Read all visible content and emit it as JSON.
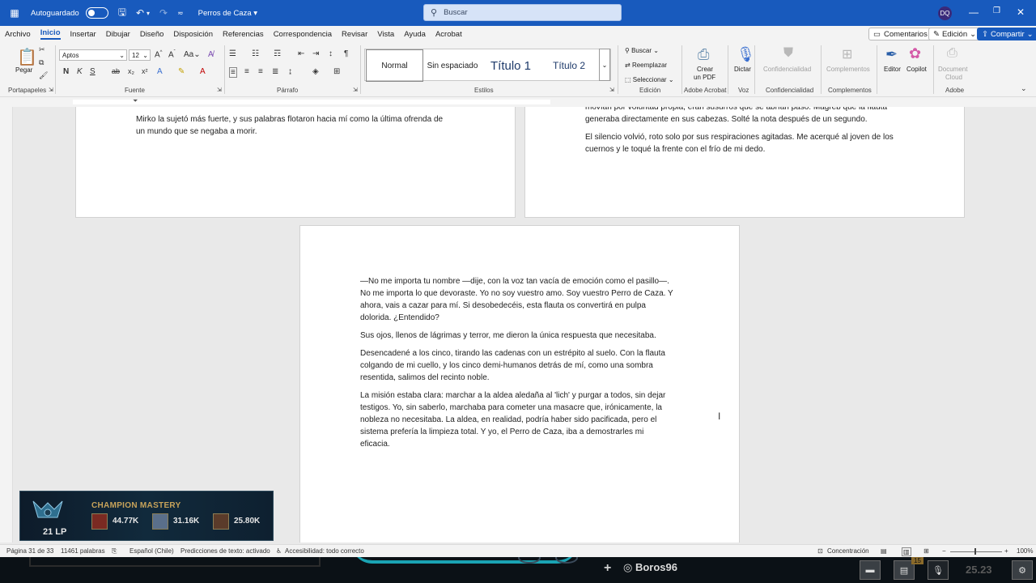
{
  "titlebar": {
    "autosave_label": "Autoguardado",
    "doc_title": "Perros de Caza",
    "search_placeholder": "Buscar",
    "user_initials": "DQ"
  },
  "menu": {
    "items": [
      "Archivo",
      "Inicio",
      "Insertar",
      "Dibujar",
      "Diseño",
      "Disposición",
      "Referencias",
      "Correspondencia",
      "Revisar",
      "Vista",
      "Ayuda",
      "Acrobat"
    ],
    "active": "Inicio",
    "comments_label": "Comentarios",
    "editing_label": "Edición",
    "share_label": "Compartir"
  },
  "ribbon": {
    "paste_label": "Pegar",
    "clipboard_label": "Portapapeles",
    "font_name": "Aptos",
    "font_size": "12",
    "font_label": "Fuente",
    "paragraph_label": "Párrafo",
    "styles_label": "Estilos",
    "styles": [
      "Normal",
      "Sin espaciado",
      "Título 1",
      "Título 2"
    ],
    "find_label": "Buscar",
    "replace_label": "Reemplazar",
    "select_label": "Seleccionar",
    "editing_group_label": "Edición",
    "create_pdf_line1": "Crear",
    "create_pdf_line2": "un PDF",
    "adobe_acrobat_label": "Adobe Acrobat",
    "dictate_label": "Dictar",
    "voice_label": "Voz",
    "confidentiality_btn": "Confidencialidad",
    "confidentiality_label": "Confidencialidad",
    "addins_btn": "Complementos",
    "addins_label": "Complementos",
    "editor_label": "Editor",
    "copilot_label": "Copilot",
    "document_cloud_line1": "Document",
    "document_cloud_line2": "Cloud",
    "adobe_label": "Adobe"
  },
  "pages": {
    "left_top": {
      "lines": [
        "Mirko la sujetó más fuerte, y sus palabras flotaron hacia mí como la última ofrenda de",
        "un mundo que se negaba a morir."
      ]
    },
    "right_top": {
      "p1_lines": [
        "movían por voluntad propia, eran susurros que se abrían paso. Magreb que la flauta",
        "generaba directamente en sus cabezas. Solté la nota después de un segundo."
      ],
      "p2_lines": [
        "El silencio volvió, roto solo por sus respiraciones agitadas. Me acerqué al joven de los",
        "cuernos y le toqué la frente con el frío de mi dedo."
      ]
    },
    "main": {
      "paragraphs": [
        [
          "—No me importa tu nombre —dije, con la voz tan vacía de emoción como el pasillo—.",
          "No me importa lo que devoraste. Yo no soy vuestro amo. Soy vuestro Perro de Caza. Y",
          "ahora, vais a cazar para mí. Si desobedecéis, esta flauta os convertirá en pulpa",
          "dolorida. ¿Entendido?"
        ],
        [
          "Sus ojos, llenos de lágrimas y terror, me dieron la única respuesta que necesitaba."
        ],
        [
          "Desencadené a los cinco, tirando las cadenas con un estrépito al suelo. Con la flauta",
          "colgando de mi cuello, y los cinco demi-humanos detrás de mí, como una sombra",
          "resentida, salimos del recinto noble."
        ],
        [
          "La misión estaba clara: marchar a la aldea aledaña al 'lich' y purgar a todos, sin dejar",
          "testigos. Yo, sin saberlo, marchaba para cometer una masacre que, irónicamente, la",
          "nobleza no necesitaba. La aldea, en realidad, podría haber sido pacificada, pero el",
          "sistema prefería la limpieza total. Y yo, el Perro de Caza, iba a demostrarles mi",
          "eficacia."
        ]
      ]
    }
  },
  "mastery": {
    "title": "CHAMPION MASTERY",
    "lp": "21 LP",
    "champions": [
      {
        "points": "44.77K",
        "color": "#7a2a22"
      },
      {
        "points": "31.16K",
        "color": "#5a6f8a"
      },
      {
        "points": "25.80K",
        "color": "#5a3b2a"
      }
    ]
  },
  "statusbar": {
    "page": "Página 31 de 33",
    "words": "11461 palabras",
    "language": "Español (Chile)",
    "predictions": "Predicciones de texto: activado",
    "accessibility": "Accesibilidad: todo correcto",
    "focus": "Concentración",
    "zoom": "100%"
  },
  "gamebar": {
    "player_name": "Boros96",
    "timer": "25.23",
    "level_badge": "15"
  },
  "colors": {
    "accent": "#185abd",
    "gold": "#c7a35a"
  }
}
